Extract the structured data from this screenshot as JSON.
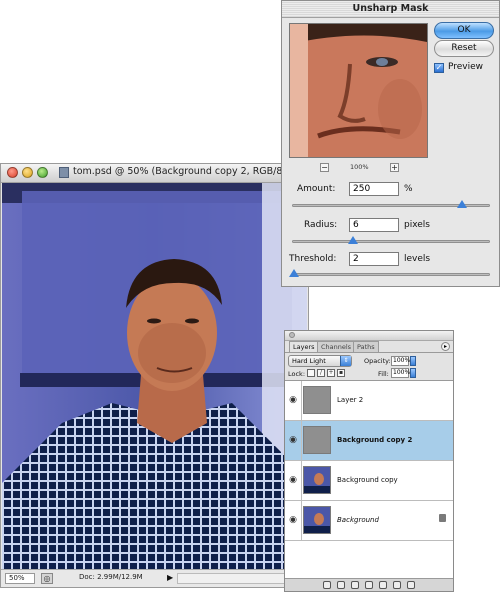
{
  "document_window": {
    "title": "tom.psd @ 50% (Background copy 2, RGB/8)",
    "zoom": "50%",
    "doc_info": "Doc: 2.99M/12.9M",
    "status_arrow": "▶"
  },
  "unsharp_mask": {
    "title": "Unsharp Mask",
    "ok_label": "OK",
    "reset_label": "Reset",
    "preview_label": "Preview",
    "preview_checked": true,
    "preview_zoom": "100%",
    "zoom_out": "−",
    "zoom_in": "+",
    "amount": {
      "label": "Amount:",
      "value": "250",
      "unit": "%",
      "slider_fraction": 0.86
    },
    "radius": {
      "label": "Radius:",
      "value": "6",
      "unit": "pixels",
      "slider_fraction": 0.31
    },
    "threshold": {
      "label": "Threshold:",
      "value": "2",
      "unit": "levels",
      "slider_fraction": 0.01
    }
  },
  "layers_panel": {
    "tabs": [
      "Layers",
      "Channels",
      "Paths"
    ],
    "blend_mode": "Hard Light",
    "opacity_label": "Opacity:",
    "opacity": "100%",
    "lock_label": "Lock:",
    "fill_label": "Fill:",
    "fill": "100%",
    "layers": [
      {
        "name": "Layer 2",
        "thumb": "gray",
        "selected": false,
        "locked": false
      },
      {
        "name": "Background copy 2",
        "thumb": "gray",
        "selected": true,
        "locked": false
      },
      {
        "name": "Background copy",
        "thumb": "photo",
        "selected": false,
        "locked": false
      },
      {
        "name": "Background",
        "thumb": "photo",
        "selected": false,
        "locked": true
      }
    ]
  },
  "colors": {
    "selection": "#a7cde9",
    "accent": "#3c80d8"
  }
}
